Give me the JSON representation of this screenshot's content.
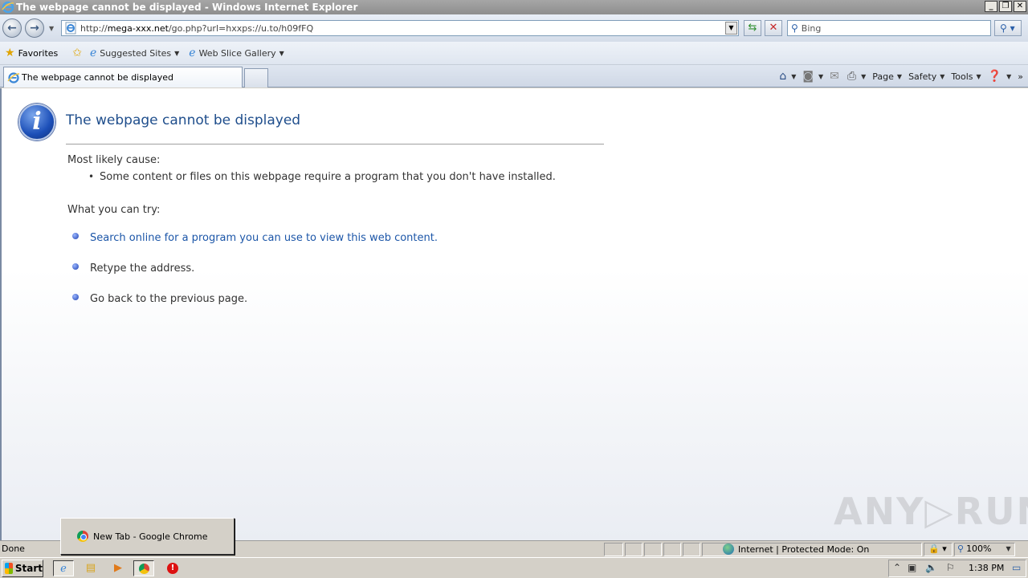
{
  "window": {
    "title": "The webpage cannot be displayed - Windows Internet Explorer",
    "buttons": [
      "_",
      "❐",
      "✕"
    ]
  },
  "navigation": {
    "back_glyph": "←",
    "forward_glyph": "→",
    "url_prefix": "http://",
    "url_domain": "mega-xxx.net",
    "url_path": "/go.php?url=hxxps://u.to/h09fFQ",
    "search_placeholder": "Bing"
  },
  "favorites_bar": {
    "favorites_label": "Favorites",
    "items": [
      {
        "label": "Suggested Sites"
      },
      {
        "label": "Web Slice Gallery"
      }
    ]
  },
  "tabs": [
    {
      "label": "The webpage cannot be displayed",
      "active": true
    }
  ],
  "command_bar": {
    "page_label": "Page",
    "safety_label": "Safety",
    "tools_label": "Tools"
  },
  "content": {
    "heading": "The webpage cannot be displayed",
    "cause_title": "Most likely cause:",
    "cause_item": "Some content or files on this webpage require a program that you don't have installed.",
    "try_title": "What you can try:",
    "try_items": [
      {
        "text": "Search online for a program you can use to view this web content.",
        "link": true
      },
      {
        "text": "Retype the address.",
        "link": false
      },
      {
        "text": "Go back to the previous page.",
        "link": false
      }
    ]
  },
  "status_bar": {
    "status": "Done",
    "zone": "Internet | Protected Mode: On",
    "zoom": "100%"
  },
  "taskbar": {
    "start_label": "Start",
    "clock": "1:38 PM",
    "popup_label": "New Tab - Google Chrome"
  },
  "watermark": "ANY▷RUN",
  "colors": {
    "heading": "#1f4e8c",
    "link": "#1c56a8",
    "taskbar": "#d4d0c8"
  }
}
